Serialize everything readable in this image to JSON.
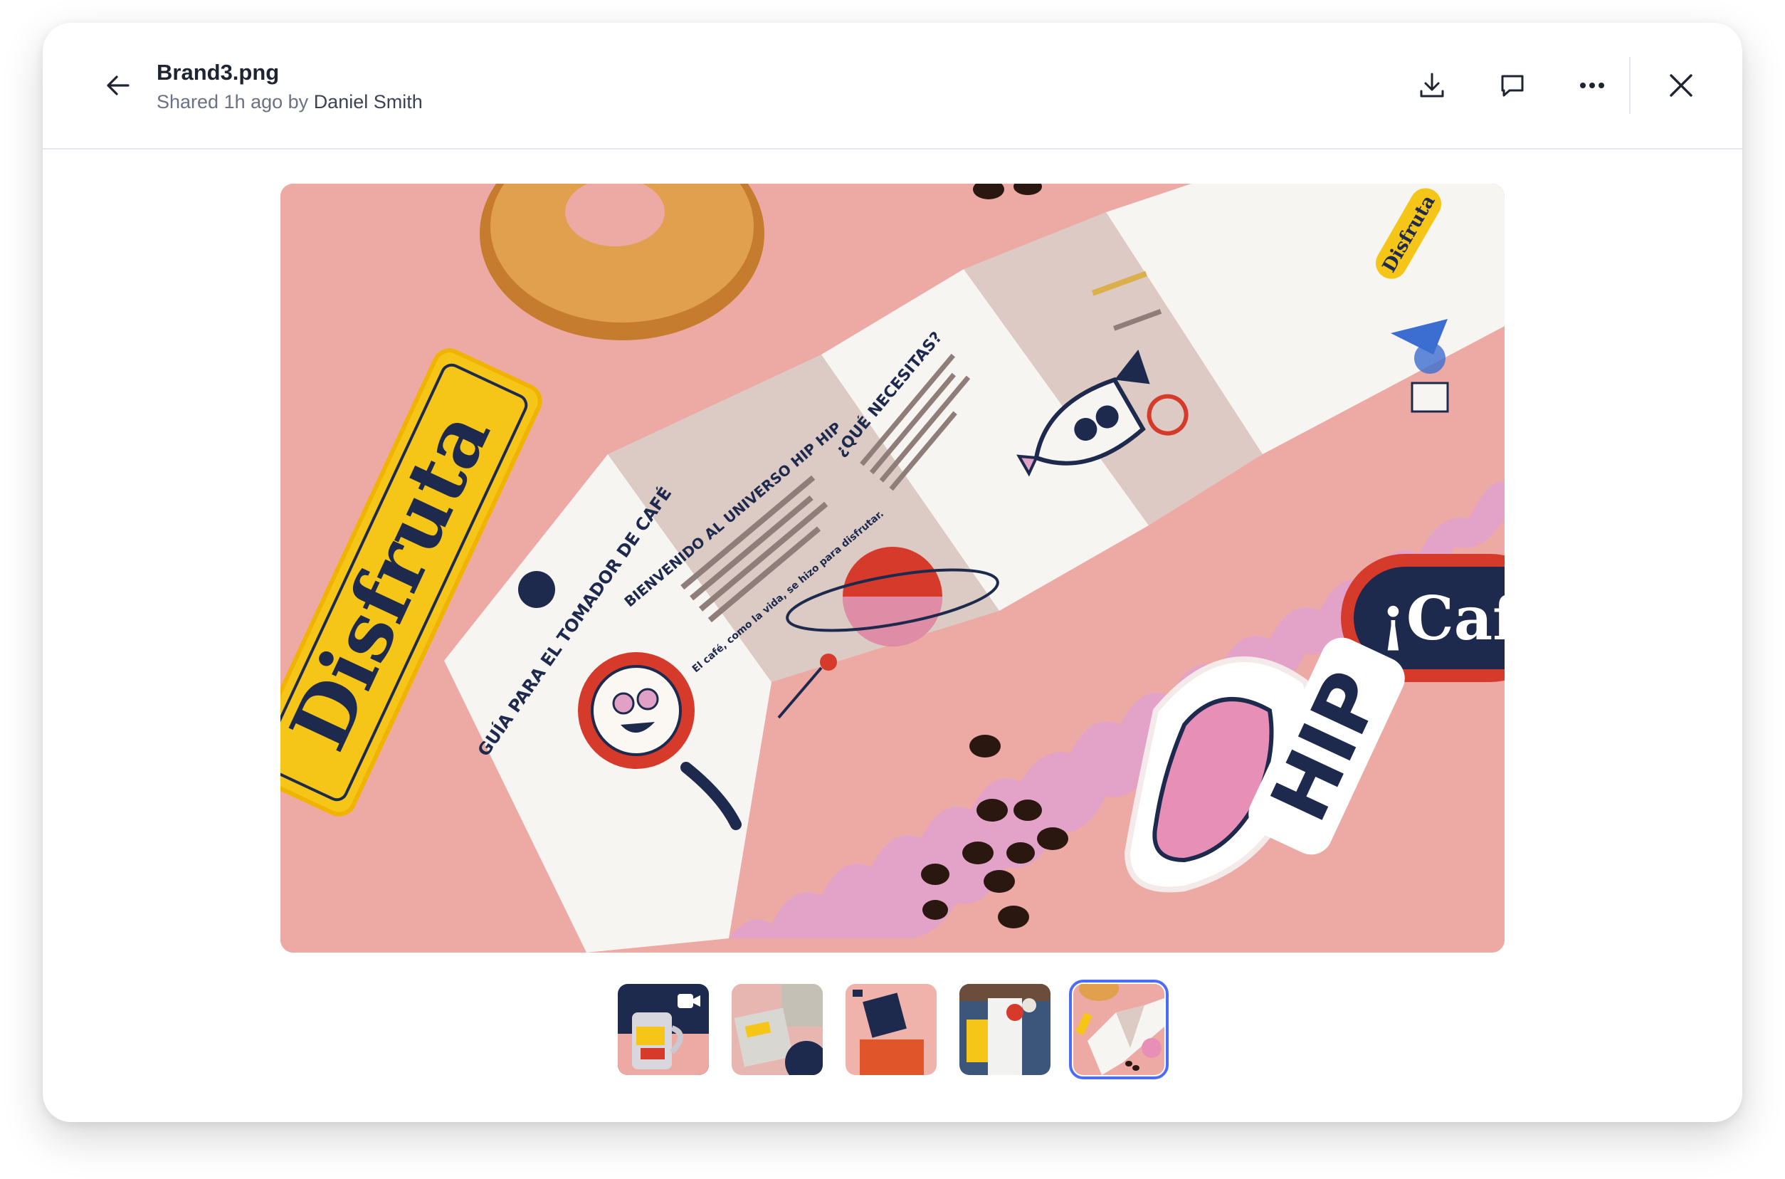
{
  "header": {
    "file_name": "Brand3.png",
    "shared_prefix": "Shared 1h ago by",
    "shared_by": "Daniel Smith"
  },
  "icons": {
    "back": "arrow-left-icon",
    "download": "download-icon",
    "comment": "comment-icon",
    "more": "more-horizontal-icon",
    "close": "close-icon",
    "video": "video-camera-icon"
  },
  "preview": {
    "sticker_disfruta": "Disfruta",
    "sticker_cafe": "¡Caf",
    "sticker_hip": "HIP",
    "panel1_title": "GUÍA PARA EL TOMADOR DE CAFÉ",
    "panel2_title": "BIENVENIDO AL UNIVERSO HIP HIP",
    "panel2_footer": "El café, como la vida, se hizo para disfrutar.",
    "panel3_title": "¿QUÉ NECESITAS?",
    "panel5_tag": "Disfruta"
  },
  "thumbnails": [
    {
      "name": "thumbnail-mug-video",
      "active": false,
      "video": true
    },
    {
      "name": "thumbnail-packaging",
      "active": false,
      "video": false
    },
    {
      "name": "thumbnail-coffee-bags",
      "active": false,
      "video": false
    },
    {
      "name": "thumbnail-denim-jacket",
      "active": false,
      "video": false
    },
    {
      "name": "thumbnail-brochure",
      "active": true,
      "video": false
    }
  ],
  "colors": {
    "accent": "#4a6cf7",
    "background_pink": "#eda9a4",
    "brand_yellow": "#f5c518",
    "brand_navy": "#1d2a4d",
    "brand_red": "#d63a2a"
  }
}
